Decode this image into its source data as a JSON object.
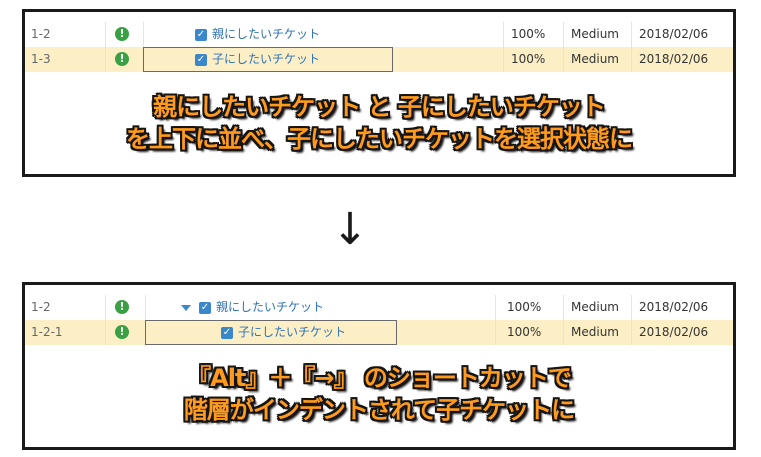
{
  "before": {
    "rows": [
      {
        "id": "1-2",
        "status_icon": "info-icon",
        "subject": "親にしたいチケット",
        "progress": "100%",
        "priority": "Medium",
        "date": "2018/02/06",
        "selected": false
      },
      {
        "id": "1-3",
        "status_icon": "info-icon",
        "subject": "子にしたいチケット",
        "progress": "100%",
        "priority": "Medium",
        "date": "2018/02/06",
        "selected": true
      }
    ],
    "caption_line1": "親にしたいチケット と 子にしたいチケット",
    "caption_line2": "を上下に並べ、子にしたいチケットを選択状態に"
  },
  "arrow": "↓",
  "after": {
    "rows": [
      {
        "id": "1-2",
        "status_icon": "info-icon",
        "subject": "親にしたいチケット",
        "progress": "100%",
        "priority": "Medium",
        "date": "2018/02/06",
        "selected": false,
        "expanded": true
      },
      {
        "id": "1-2-1",
        "status_icon": "info-icon",
        "subject": "子にしたいチケット",
        "progress": "100%",
        "priority": "Medium",
        "date": "2018/02/06",
        "selected": true
      }
    ],
    "caption_line1": "『Alt』＋『→』 のショートカットで",
    "caption_line2": "階層がインデントされて子チケットに"
  },
  "icons": {
    "status": "!",
    "checkbox": "✓"
  },
  "colors": {
    "highlight": "#fcefc6",
    "link": "#2f73b8",
    "status_green": "#39a043",
    "caption_orange": "#ff9a1c"
  }
}
